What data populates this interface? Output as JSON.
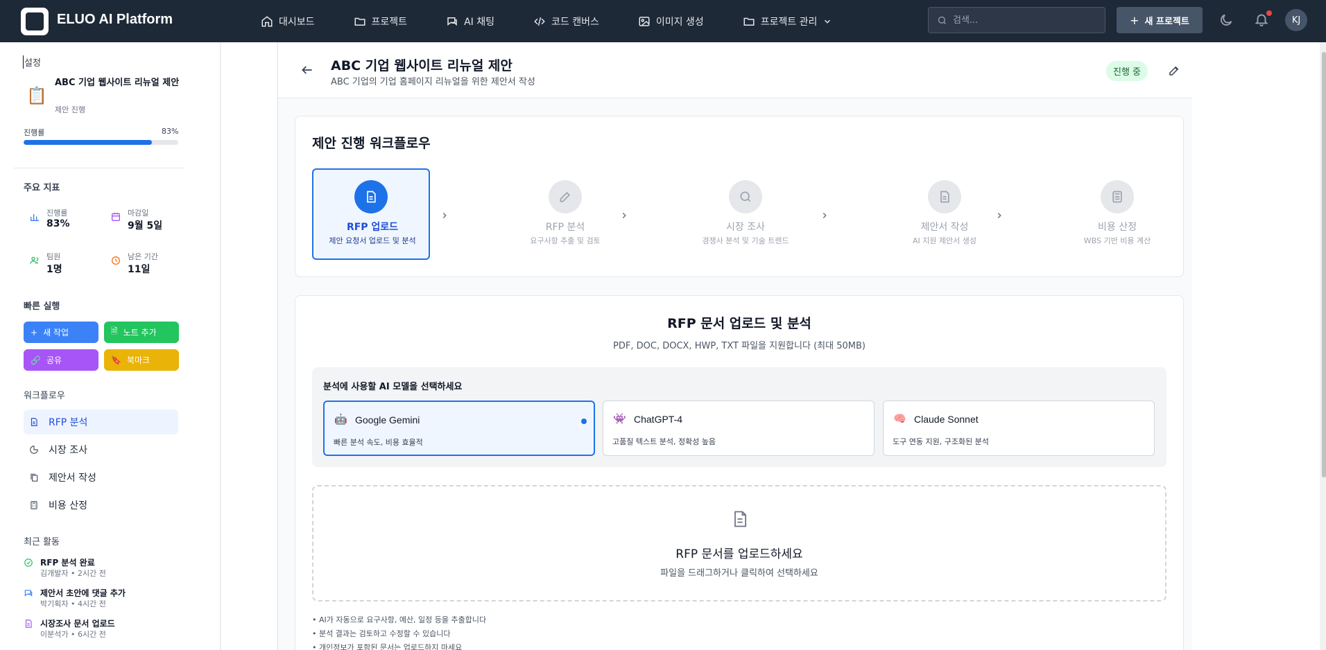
{
  "app": {
    "title": "ELUO AI Platform"
  },
  "nav": {
    "items": [
      {
        "label": "대시보드",
        "icon": "home-icon"
      },
      {
        "label": "프로젝트",
        "icon": "folder-icon"
      },
      {
        "label": "AI 채팅",
        "icon": "chat-icon"
      },
      {
        "label": "코드 캔버스",
        "icon": "code-icon"
      },
      {
        "label": "이미지 생성",
        "icon": "image-icon"
      },
      {
        "label": "프로젝트 관리",
        "icon": "folder-icon"
      }
    ],
    "search_placeholder": "검색...",
    "new_project_label": "새 프로젝트",
    "avatar_initials": "KJ"
  },
  "sidebar": {
    "settings_label": "설정",
    "project": {
      "name": "ABC 기업 웹사이트 리뉴얼 제안",
      "status": "제안 진행",
      "progress_label": "진행률",
      "progress_text": "83%",
      "progress": 0.83
    },
    "metrics_title": "주요 지표",
    "metrics": [
      {
        "label": "진행률",
        "value": "83%",
        "icon": "bar-chart-icon"
      },
      {
        "label": "마감일",
        "value": "9월 5일",
        "icon": "calendar-icon"
      },
      {
        "label": "팀원",
        "value": "1명",
        "icon": "users-icon"
      },
      {
        "label": "남은 기간",
        "value": "11일",
        "icon": "clock-icon"
      }
    ],
    "quick_title": "빠른 실행",
    "quick_actions": [
      {
        "label": "새 작업",
        "color": "#3b82f6"
      },
      {
        "label": "노트 추가",
        "color": "#22c55e"
      },
      {
        "label": "공유",
        "color": "#a855f7"
      },
      {
        "label": "북마크",
        "color": "#eab308"
      }
    ],
    "workflow_title": "워크플로우",
    "workflow_items": [
      {
        "label": "RFP 분석",
        "active": true
      },
      {
        "label": "시장 조사",
        "active": false
      },
      {
        "label": "제안서 작성",
        "active": false
      },
      {
        "label": "비용 산정",
        "active": false
      }
    ],
    "recent_title": "최근 활동",
    "recent": [
      {
        "title": "RFP 분석 완료",
        "meta": "김개발자 • 2시간 전"
      },
      {
        "title": "제안서 초안에 댓글 추가",
        "meta": "박기획자 • 4시간 전"
      },
      {
        "title": "시장조사 문서 업로드",
        "meta": "이분석가 • 6시간 전"
      }
    ]
  },
  "header": {
    "title": "ABC 기업 웹사이트 리뉴얼 제안",
    "subtitle": "ABC 기업의 기업 홈페이지 리뉴얼을 위한 제안서 작성",
    "status": "진행 중"
  },
  "workflow": {
    "title": "제안 진행 워크플로우",
    "steps": [
      {
        "name": "RFP 업로드",
        "desc": "제안 요청서 업로드 및 분석",
        "active": true
      },
      {
        "name": "RFP 분석",
        "desc": "요구사항 추출 및 검토",
        "active": false
      },
      {
        "name": "시장 조사",
        "desc": "경쟁사 분석 및 기술 트렌드",
        "active": false
      },
      {
        "name": "제안서 작성",
        "desc": "AI 지원 제안서 생성",
        "active": false
      },
      {
        "name": "비용 산정",
        "desc": "WBS 기반 비용 계산",
        "active": false
      }
    ]
  },
  "upload": {
    "title": "RFP 문서 업로드 및 분석",
    "subtitle": "PDF, DOC, DOCX, HWP, TXT 파일을 지원합니다 (최대 50MB)",
    "model_label": "분석에 사용할 AI 모델을 선택하세요",
    "models": [
      {
        "name": "Google Gemini",
        "desc": "빠른 분석 속도, 비용 효율적",
        "selected": true
      },
      {
        "name": "ChatGPT-4",
        "desc": "고품질 텍스트 분석, 정확성 높음",
        "selected": false
      },
      {
        "name": "Claude Sonnet",
        "desc": "도구 연동 지원, 구조화된 분석",
        "selected": false
      }
    ],
    "drop_title": "RFP 문서를 업로드하세요",
    "drop_sub": "파일을 드래그하거나 클릭하여 선택하세요",
    "notes": [
      "• AI가 자동으로 요구사항, 예산, 일정 등을 추출합니다",
      "• 분석 결과는 검토하고 수정할 수 있습니다",
      "• 개인정보가 포함된 문서는 업로드하지 마세요"
    ]
  }
}
